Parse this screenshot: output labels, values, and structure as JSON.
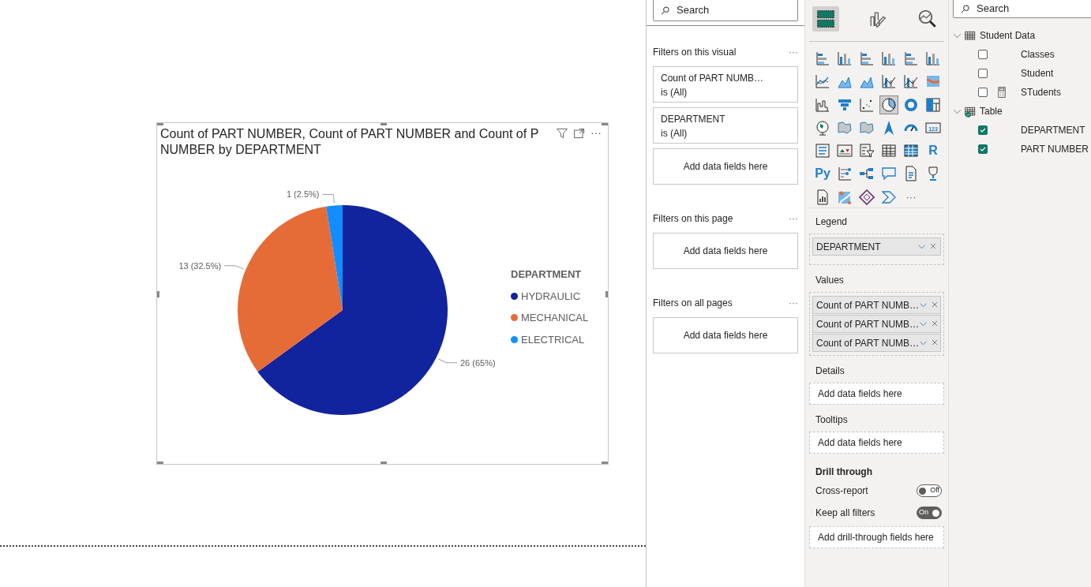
{
  "canvas": {
    "visual": {
      "title_lines": [
        "Count of PART NUMBER, Count of PART NUMBER and Count of P",
        "NUMBER by DEPARTMENT"
      ],
      "more": "···",
      "chart_data": {
        "type": "pie",
        "categories": [
          "HYDRAULIC",
          "MECHANICAL",
          "ELECTRICAL"
        ],
        "colors": [
          "#12239e",
          "#e66c37",
          "#118dff"
        ],
        "series": [
          {
            "values": [
              65,
              32.5,
              2.5
            ]
          }
        ],
        "value_labels": [
          "26 (65%)",
          "13 (32.5%)",
          "1 (2.5%)"
        ],
        "legend": "right"
      },
      "legend_title": "DEPARTMENT"
    }
  },
  "filters": {
    "search": {
      "placeholder": "Search"
    },
    "sections": [
      {
        "title": "Filters on this visual",
        "more": "···",
        "cards": [
          {
            "kind": "filter",
            "field": "Count of PART NUMB…",
            "condition": "is (All)"
          },
          {
            "kind": "filter",
            "field": "DEPARTMENT",
            "condition": "is (All)"
          },
          {
            "kind": "drop",
            "text": "Add data fields here"
          }
        ]
      },
      {
        "title": "Filters on this page",
        "more": "···",
        "cards": [
          {
            "kind": "drop",
            "text": "Add data fields here"
          }
        ]
      },
      {
        "title": "Filters on all pages",
        "more": "···",
        "cards": [
          {
            "kind": "drop",
            "text": "Add data fields here"
          }
        ]
      }
    ]
  },
  "visualizations": {
    "tabs": [
      {
        "kind": "build",
        "selected": true
      },
      {
        "kind": "format",
        "selected": false
      },
      {
        "kind": "analytics",
        "selected": false
      }
    ],
    "gallery": [
      {
        "kind": "bar",
        "selected": false
      },
      {
        "kind": "column",
        "selected": false
      },
      {
        "kind": "bar",
        "selected": false
      },
      {
        "kind": "column",
        "selected": false
      },
      {
        "kind": "bar",
        "selected": false
      },
      {
        "kind": "column",
        "selected": false
      },
      {
        "kind": "line",
        "selected": false
      },
      {
        "kind": "area",
        "selected": false
      },
      {
        "kind": "area",
        "selected": false
      },
      {
        "kind": "combo",
        "selected": false
      },
      {
        "kind": "combo",
        "selected": false
      },
      {
        "kind": "ribbon",
        "selected": false
      },
      {
        "kind": "waterfall",
        "selected": false
      },
      {
        "kind": "funnel",
        "selected": false
      },
      {
        "kind": "scatter",
        "selected": false
      },
      {
        "kind": "pie",
        "selected": true
      },
      {
        "kind": "donut",
        "selected": false
      },
      {
        "kind": "treemap",
        "selected": false
      },
      {
        "kind": "globe",
        "selected": false
      },
      {
        "kind": "map",
        "selected": false
      },
      {
        "kind": "map",
        "selected": false
      },
      {
        "kind": "arrow",
        "selected": false
      },
      {
        "kind": "gauge",
        "selected": false
      },
      {
        "kind": "card",
        "label": "123",
        "selected": false
      },
      {
        "kind": "list",
        "selected": false
      },
      {
        "kind": "kpi",
        "selected": false
      },
      {
        "kind": "slicer",
        "selected": false
      },
      {
        "kind": "table",
        "selected": false
      },
      {
        "kind": "matrix",
        "selected": false
      },
      {
        "kind": "glyph",
        "label": "R",
        "selected": false
      },
      {
        "kind": "glyph",
        "label": "Py",
        "selected": false
      },
      {
        "kind": "influencers",
        "selected": false
      },
      {
        "kind": "tree",
        "selected": false
      },
      {
        "kind": "chat",
        "selected": false
      },
      {
        "kind": "doc",
        "selected": false
      },
      {
        "kind": "trophy",
        "selected": false
      },
      {
        "kind": "report",
        "selected": false
      },
      {
        "kind": "arcgis",
        "selected": false
      },
      {
        "kind": "apps",
        "selected": false
      },
      {
        "kind": "automate",
        "selected": false
      }
    ],
    "gallery_more": "···",
    "wells": [
      {
        "title": "Legend",
        "fields": [
          "DEPARTMENT"
        ]
      },
      {
        "title": "Values",
        "fields": [
          "Count of PART NUMB…",
          "Count of PART NUMB…",
          "Count of PART NUMB…"
        ]
      },
      {
        "title": "Details",
        "drop_text": "Add data fields here"
      },
      {
        "title": "Tooltips",
        "drop_text": "Add data fields here"
      }
    ],
    "drill_through": {
      "title": "Drill through",
      "toggles": [
        {
          "label": "Cross-report",
          "on": false,
          "text": "Off"
        },
        {
          "label": "Keep all filters",
          "on": true,
          "text": "On"
        }
      ],
      "drop_text": "Add drill-through fields here"
    }
  },
  "fields": {
    "search": {
      "placeholder": "Search"
    },
    "tables": [
      {
        "name": "Student Data",
        "kind": "table",
        "expanded": true,
        "children": [
          {
            "name": "Classes",
            "kind": "column",
            "checked": false
          },
          {
            "name": "Student",
            "kind": "column",
            "checked": false
          },
          {
            "name": "STudents",
            "kind": "measure",
            "checked": false
          }
        ]
      },
      {
        "name": "Table",
        "kind": "used",
        "expanded": true,
        "children": [
          {
            "name": "DEPARTMENT",
            "kind": "column",
            "checked": true
          },
          {
            "name": "PART NUMBER",
            "kind": "column",
            "checked": true
          }
        ]
      }
    ]
  }
}
